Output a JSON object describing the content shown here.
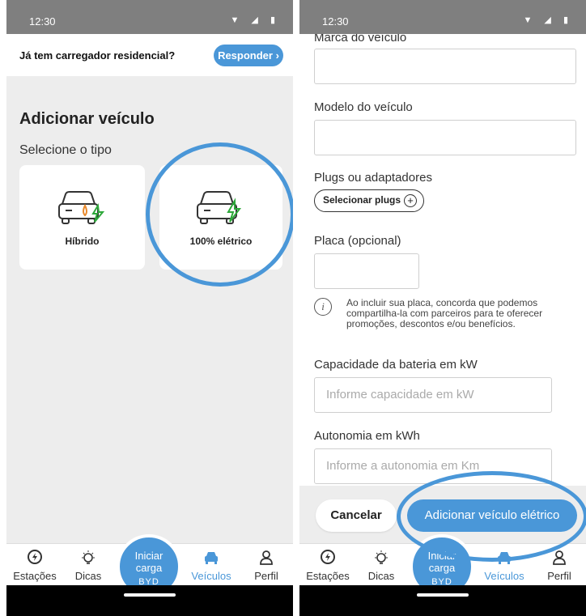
{
  "colors": {
    "accent": "#4a97d8",
    "status_bar": "#7f7f7f",
    "background": "#ededed"
  },
  "status": {
    "time": "12:30",
    "icons": "▼ ◢ ▮"
  },
  "left": {
    "banner_text": "Já tem carregador residencial?",
    "banner_button": "Responder",
    "title": "Adicionar veículo",
    "subtitle": "Selecione o tipo",
    "types": [
      {
        "label": "Híbrido",
        "icon": "hybrid-car-icon"
      },
      {
        "label": "100% elétrico",
        "icon": "electric-car-icon"
      }
    ]
  },
  "right": {
    "brand_label": "Marca do veículo",
    "model_label": "Modelo do veículo",
    "plugs_label": "Plugs ou adaptadores",
    "plugs_button": "Selecionar plugs",
    "plugs_plus": "+",
    "plate_label": "Placa (opcional)",
    "info_icon": "i",
    "info_text": "Ao incluir sua placa, concorda que podemos compartilha-la com parceiros para te oferecer promoções, descontos e/ou benefícios.",
    "battery_label": "Capacidade da bateria em kW",
    "battery_placeholder": "Informe capacidade em kW",
    "range_label": "Autonomia em kWh",
    "range_placeholder": "Informe a autonomia em Km",
    "cancel": "Cancelar",
    "submit": "Adicionar veículo elétrico"
  },
  "nav": {
    "items": [
      "Estações",
      "Dicas",
      "Veículos",
      "Perfil"
    ],
    "fab_line1": "Iniciar",
    "fab_line2": "carga",
    "fab_brand": "BYD"
  }
}
